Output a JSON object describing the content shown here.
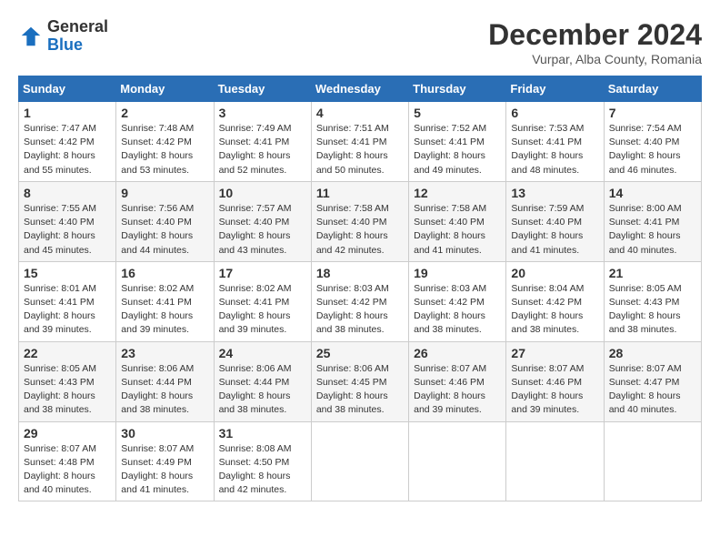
{
  "header": {
    "logo_general": "General",
    "logo_blue": "Blue",
    "month_title": "December 2024",
    "location": "Vurpar, Alba County, Romania"
  },
  "days_of_week": [
    "Sunday",
    "Monday",
    "Tuesday",
    "Wednesday",
    "Thursday",
    "Friday",
    "Saturday"
  ],
  "weeks": [
    [
      {
        "day": "1",
        "sunrise": "7:47 AM",
        "sunset": "4:42 PM",
        "daylight": "8 hours and 55 minutes."
      },
      {
        "day": "2",
        "sunrise": "7:48 AM",
        "sunset": "4:42 PM",
        "daylight": "8 hours and 53 minutes."
      },
      {
        "day": "3",
        "sunrise": "7:49 AM",
        "sunset": "4:41 PM",
        "daylight": "8 hours and 52 minutes."
      },
      {
        "day": "4",
        "sunrise": "7:51 AM",
        "sunset": "4:41 PM",
        "daylight": "8 hours and 50 minutes."
      },
      {
        "day": "5",
        "sunrise": "7:52 AM",
        "sunset": "4:41 PM",
        "daylight": "8 hours and 49 minutes."
      },
      {
        "day": "6",
        "sunrise": "7:53 AM",
        "sunset": "4:41 PM",
        "daylight": "8 hours and 48 minutes."
      },
      {
        "day": "7",
        "sunrise": "7:54 AM",
        "sunset": "4:40 PM",
        "daylight": "8 hours and 46 minutes."
      }
    ],
    [
      {
        "day": "8",
        "sunrise": "7:55 AM",
        "sunset": "4:40 PM",
        "daylight": "8 hours and 45 minutes."
      },
      {
        "day": "9",
        "sunrise": "7:56 AM",
        "sunset": "4:40 PM",
        "daylight": "8 hours and 44 minutes."
      },
      {
        "day": "10",
        "sunrise": "7:57 AM",
        "sunset": "4:40 PM",
        "daylight": "8 hours and 43 minutes."
      },
      {
        "day": "11",
        "sunrise": "7:58 AM",
        "sunset": "4:40 PM",
        "daylight": "8 hours and 42 minutes."
      },
      {
        "day": "12",
        "sunrise": "7:58 AM",
        "sunset": "4:40 PM",
        "daylight": "8 hours and 41 minutes."
      },
      {
        "day": "13",
        "sunrise": "7:59 AM",
        "sunset": "4:40 PM",
        "daylight": "8 hours and 41 minutes."
      },
      {
        "day": "14",
        "sunrise": "8:00 AM",
        "sunset": "4:41 PM",
        "daylight": "8 hours and 40 minutes."
      }
    ],
    [
      {
        "day": "15",
        "sunrise": "8:01 AM",
        "sunset": "4:41 PM",
        "daylight": "8 hours and 39 minutes."
      },
      {
        "day": "16",
        "sunrise": "8:02 AM",
        "sunset": "4:41 PM",
        "daylight": "8 hours and 39 minutes."
      },
      {
        "day": "17",
        "sunrise": "8:02 AM",
        "sunset": "4:41 PM",
        "daylight": "8 hours and 39 minutes."
      },
      {
        "day": "18",
        "sunrise": "8:03 AM",
        "sunset": "4:42 PM",
        "daylight": "8 hours and 38 minutes."
      },
      {
        "day": "19",
        "sunrise": "8:03 AM",
        "sunset": "4:42 PM",
        "daylight": "8 hours and 38 minutes."
      },
      {
        "day": "20",
        "sunrise": "8:04 AM",
        "sunset": "4:42 PM",
        "daylight": "8 hours and 38 minutes."
      },
      {
        "day": "21",
        "sunrise": "8:05 AM",
        "sunset": "4:43 PM",
        "daylight": "8 hours and 38 minutes."
      }
    ],
    [
      {
        "day": "22",
        "sunrise": "8:05 AM",
        "sunset": "4:43 PM",
        "daylight": "8 hours and 38 minutes."
      },
      {
        "day": "23",
        "sunrise": "8:06 AM",
        "sunset": "4:44 PM",
        "daylight": "8 hours and 38 minutes."
      },
      {
        "day": "24",
        "sunrise": "8:06 AM",
        "sunset": "4:44 PM",
        "daylight": "8 hours and 38 minutes."
      },
      {
        "day": "25",
        "sunrise": "8:06 AM",
        "sunset": "4:45 PM",
        "daylight": "8 hours and 38 minutes."
      },
      {
        "day": "26",
        "sunrise": "8:07 AM",
        "sunset": "4:46 PM",
        "daylight": "8 hours and 39 minutes."
      },
      {
        "day": "27",
        "sunrise": "8:07 AM",
        "sunset": "4:46 PM",
        "daylight": "8 hours and 39 minutes."
      },
      {
        "day": "28",
        "sunrise": "8:07 AM",
        "sunset": "4:47 PM",
        "daylight": "8 hours and 40 minutes."
      }
    ],
    [
      {
        "day": "29",
        "sunrise": "8:07 AM",
        "sunset": "4:48 PM",
        "daylight": "8 hours and 40 minutes."
      },
      {
        "day": "30",
        "sunrise": "8:07 AM",
        "sunset": "4:49 PM",
        "daylight": "8 hours and 41 minutes."
      },
      {
        "day": "31",
        "sunrise": "8:08 AM",
        "sunset": "4:50 PM",
        "daylight": "8 hours and 42 minutes."
      },
      null,
      null,
      null,
      null
    ]
  ]
}
